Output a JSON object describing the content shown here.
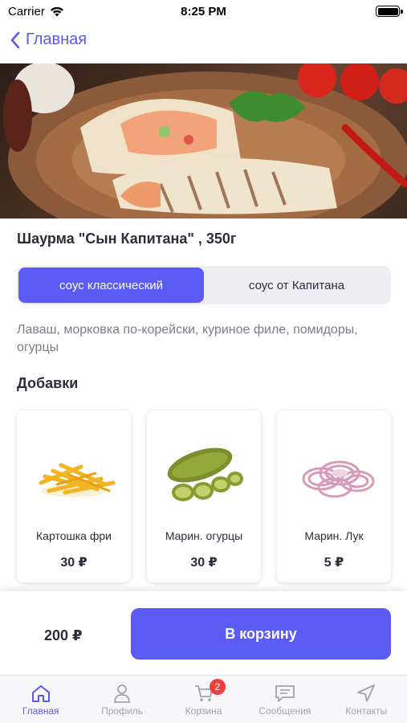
{
  "status_bar": {
    "carrier": "Carrier",
    "time": "8:25 PM"
  },
  "nav": {
    "back_label": "Главная"
  },
  "product": {
    "title": "Шаурма \"Сын Капитана\" , 350г",
    "sauces": [
      "соус классический",
      "соус от Капитана"
    ],
    "selected_sauce": "соус классический",
    "ingredients": "Лаваш, морковка по-корейски, куриное филе, помидоры, огурцы"
  },
  "addons": {
    "title": "Добавки",
    "items": [
      {
        "name": "Картошка фри",
        "price": "30 ₽"
      },
      {
        "name": "Марин. огурцы",
        "price": "30 ₽"
      },
      {
        "name": "Марин. Лук",
        "price": "5 ₽"
      }
    ]
  },
  "action": {
    "total": "200 ₽",
    "cart_button": "В корзину"
  },
  "tabs": [
    {
      "label": "Главная",
      "icon": "home-icon",
      "active": true
    },
    {
      "label": "Профиль",
      "icon": "user-icon"
    },
    {
      "label": "Корзина",
      "icon": "cart-icon",
      "badge": "2"
    },
    {
      "label": "Сообщения",
      "icon": "chat-icon"
    },
    {
      "label": "Контакты",
      "icon": "location-arrow-icon"
    }
  ],
  "colors": {
    "accent": "#5b5bf5",
    "badge": "#f03f3f",
    "text": "#2b2d3a",
    "muted": "#7b7d88"
  }
}
